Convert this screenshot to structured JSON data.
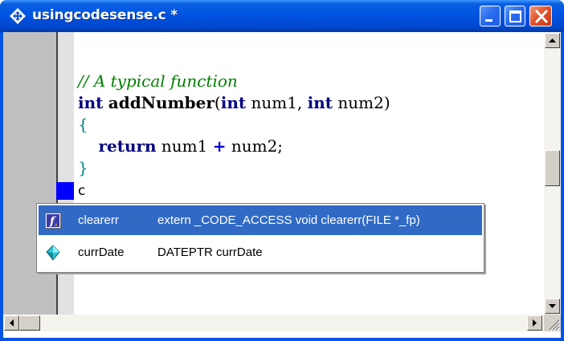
{
  "window": {
    "title": "usingcodesense.c *",
    "icons": {
      "app": "diamond-arrows-icon",
      "minimize": "minimize-icon",
      "maximize": "maximize-icon",
      "close": "close-icon"
    }
  },
  "editor": {
    "code": {
      "comment": "// A typical function",
      "line2": {
        "kw1": "int",
        "fn": "addNumber",
        "open": "(",
        "kw2": "int",
        "arg1": " num1, ",
        "kw3": "int",
        "arg2": " num2)"
      },
      "open_brace": "{",
      "line4": {
        "indent": "    ",
        "kw": "return",
        "a": " num1 ",
        "op": "+",
        "b": " num2;"
      },
      "close_brace": "}"
    },
    "typed_text": "c",
    "colors": {
      "gutter": "#c0c0c0",
      "caret_marker": "#0000ff",
      "comment": "#008000",
      "keyword": "#000080"
    }
  },
  "autocomplete": {
    "items": [
      {
        "icon": "function-icon",
        "name": "clearerr",
        "signature": "extern _CODE_ACCESS void clearerr(FILE *_fp)",
        "selected": true
      },
      {
        "icon": "variable-icon",
        "name": "currDate",
        "signature": "DATEPTR currDate",
        "selected": false
      }
    ],
    "selection_color": "#316ac5"
  },
  "scrollbars": {
    "vertical": {
      "up_icon": "arrow-up-icon",
      "down_icon": "arrow-down-icon"
    },
    "horizontal": {
      "left_icon": "arrow-left-icon",
      "right_icon": "arrow-right-icon"
    },
    "grip_icon": "resize-grip-icon"
  }
}
